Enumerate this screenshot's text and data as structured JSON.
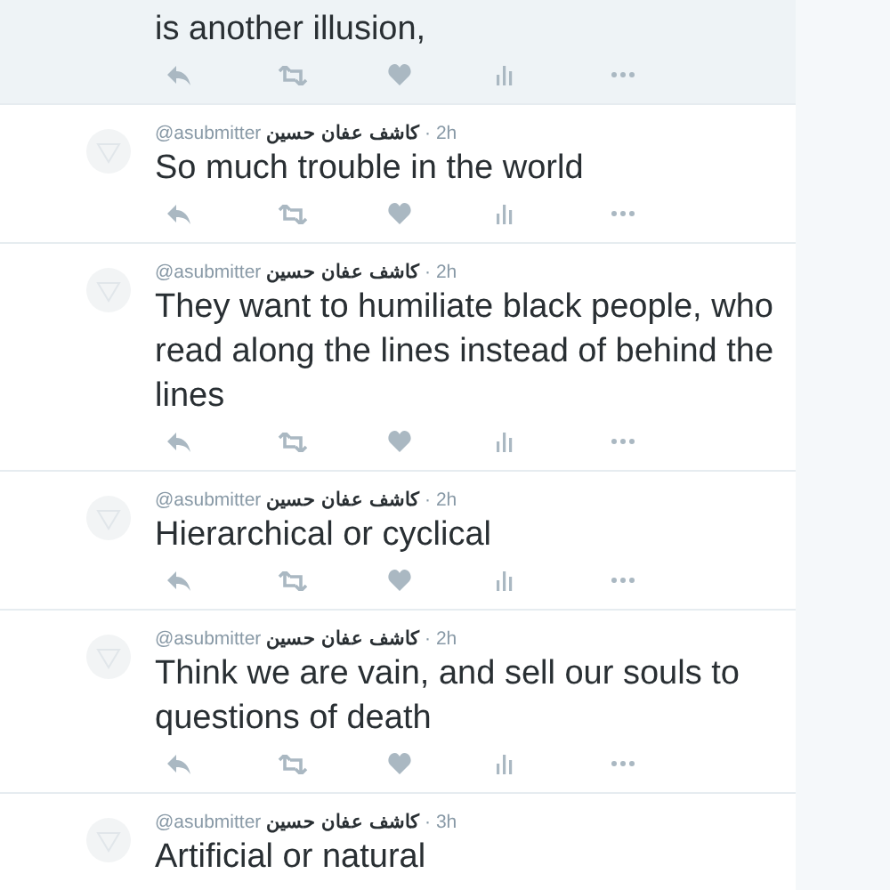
{
  "tweets": [
    {
      "highlighted": true,
      "text": "is another illusion,"
    },
    {
      "highlighted": false,
      "handle": "@asubmitter",
      "name": "كاشف عفان حسين",
      "time": "· 2h",
      "text": "So much trouble in the world"
    },
    {
      "highlighted": false,
      "handle": "@asubmitter",
      "name": "كاشف عفان حسين",
      "time": "· 2h",
      "text": "They want to humiliate black people, who read along the lines instead of behind the lines"
    },
    {
      "highlighted": false,
      "handle": "@asubmitter",
      "name": "كاشف عفان حسين",
      "time": "· 2h",
      "text": "Hierarchical or cyclical"
    },
    {
      "highlighted": false,
      "handle": "@asubmitter",
      "name": "كاشف عفان حسين",
      "time": "· 2h",
      "text": "Think we are vain, and sell our souls to questions of death"
    },
    {
      "highlighted": false,
      "handle": "@asubmitter",
      "name": "كاشف عفان حسين",
      "time": "· 3h",
      "text": "Artificial or natural",
      "actions_hidden": true
    }
  ]
}
